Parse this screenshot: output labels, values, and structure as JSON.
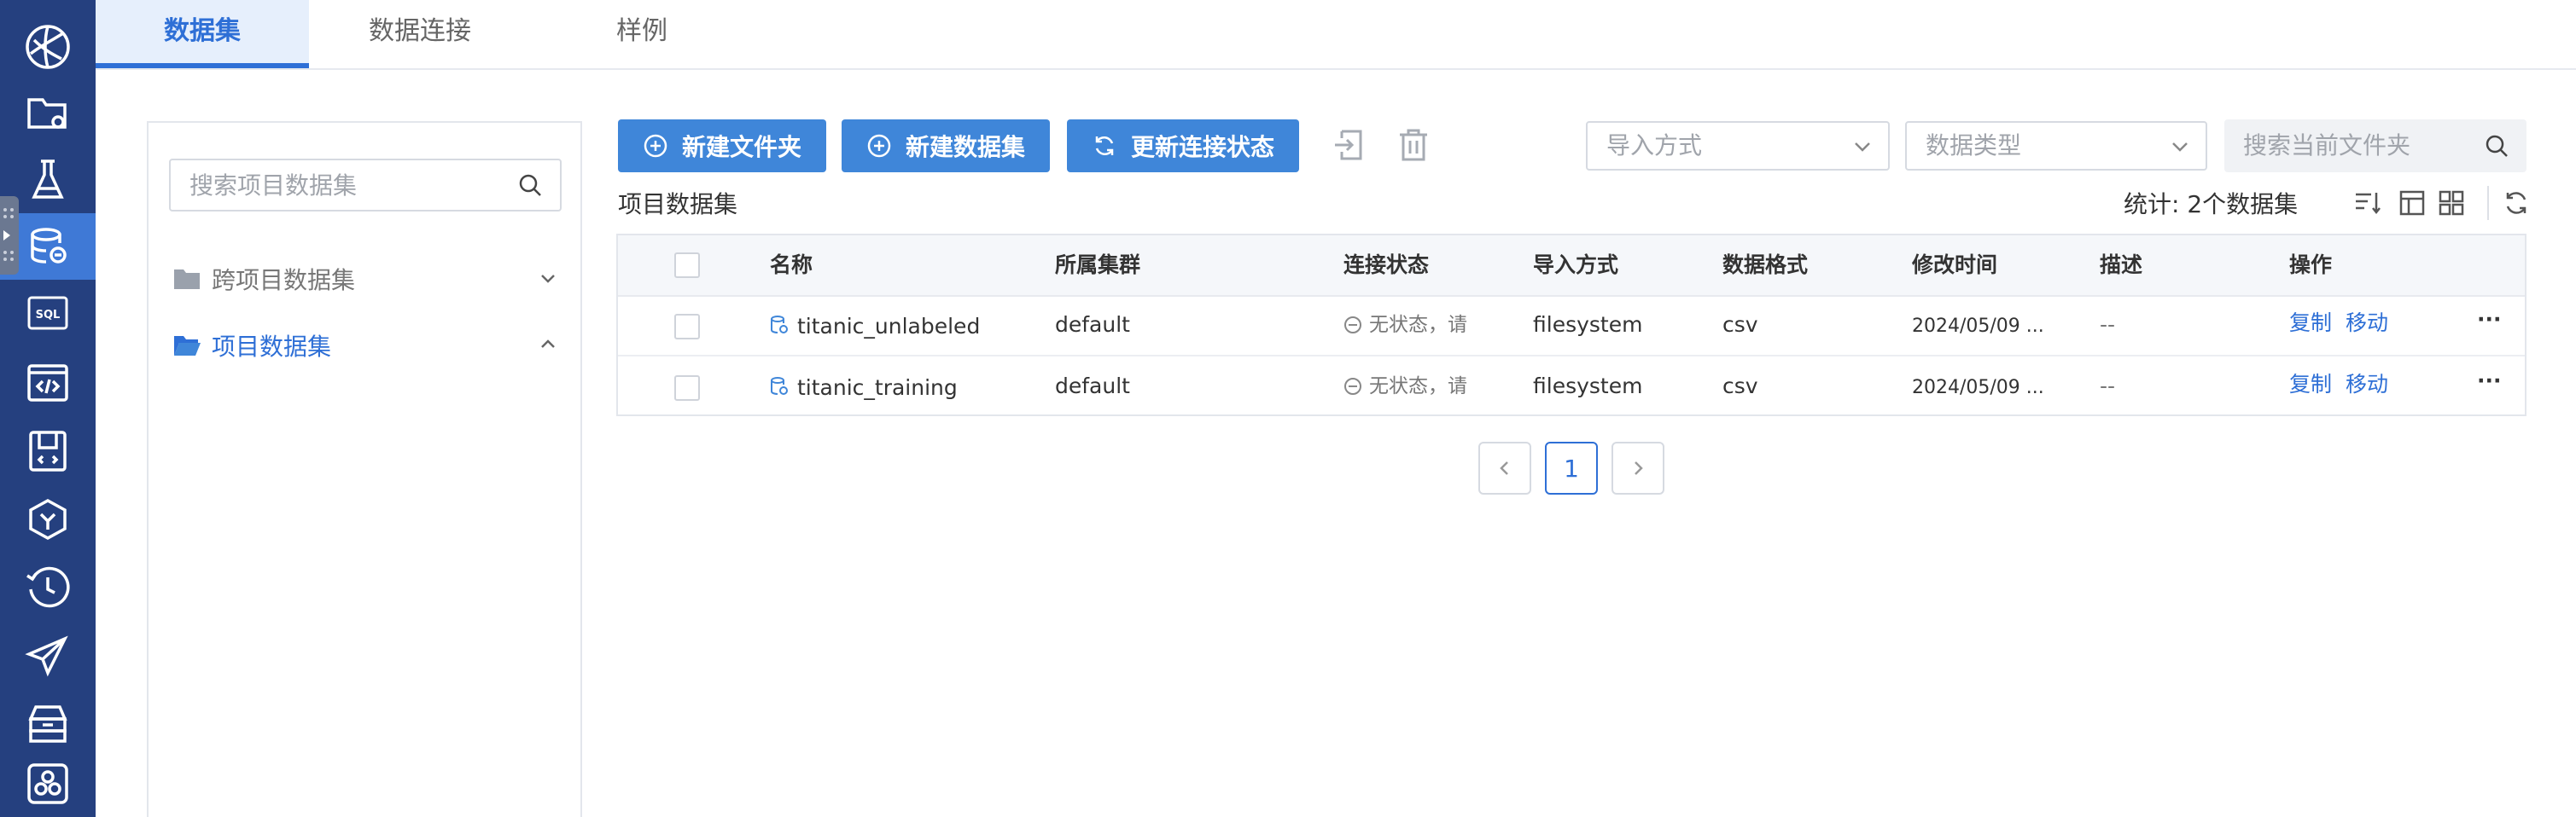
{
  "tabs": [
    "数据集",
    "数据连接",
    "样例"
  ],
  "sidebar": {
    "search_placeholder": "搜索项目数据集",
    "items": [
      {
        "label": "跨项目数据集",
        "expanded": false
      },
      {
        "label": "项目数据集",
        "expanded": true
      }
    ]
  },
  "toolbar": {
    "new_folder": "新建文件夹",
    "new_dataset": "新建数据集",
    "refresh_status": "更新连接状态",
    "import_select": "导入方式",
    "type_select": "数据类型",
    "folder_search_placeholder": "搜索当前文件夹"
  },
  "section": {
    "title": "项目数据集",
    "stats": "统计: 2个数据集"
  },
  "table": {
    "headers": [
      "名称",
      "所属集群",
      "连接状态",
      "导入方式",
      "数据格式",
      "修改时间",
      "描述",
      "操作"
    ],
    "rows": [
      {
        "name": "titanic_unlabeled",
        "cluster": "default",
        "status": "无状态，请",
        "import": "filesystem",
        "format": "csv",
        "modified": "2024/05/09 ...",
        "desc": "--",
        "copy": "复制",
        "move": "移动",
        "more": "···"
      },
      {
        "name": "titanic_training",
        "cluster": "default",
        "status": "无状态，请",
        "import": "filesystem",
        "format": "csv",
        "modified": "2024/05/09 ...",
        "desc": "--",
        "copy": "复制",
        "move": "移动",
        "more": "···"
      }
    ]
  },
  "pagination": {
    "current": "1"
  },
  "colors": {
    "rail": "#25407f",
    "rail_active": "#3f79d6",
    "accent": "#2e6fd6",
    "button": "#3f86d9"
  },
  "icons": [
    "logo-icon",
    "folder-settings-icon",
    "flask-icon",
    "database-icon",
    "sql-icon",
    "code-icon",
    "notebook-icon",
    "model-icon",
    "history-icon",
    "send-icon",
    "storage-icon",
    "apps-icon"
  ]
}
